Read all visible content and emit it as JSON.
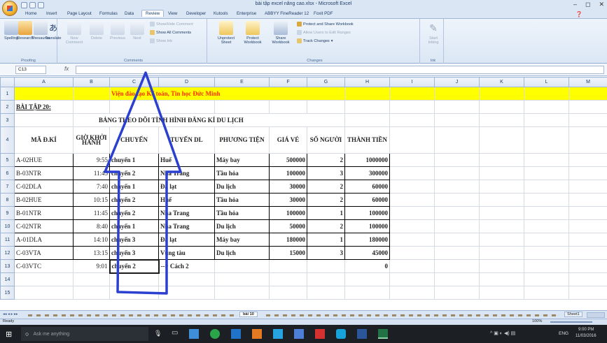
{
  "window": {
    "title": "bài tập excel nâng cao.xlsx - Microsoft Excel",
    "controls": [
      "–",
      "◻",
      "✕"
    ]
  },
  "tabs": [
    "Home",
    "Insert",
    "Page Layout",
    "Formulas",
    "Data",
    "Review",
    "View",
    "Developer",
    "Kutools",
    "Enterprise",
    "ABBYY FineReader 12",
    "Foxit PDF"
  ],
  "active_tab": "Review",
  "ribbon": {
    "proofing": {
      "label": "Proofing",
      "buttons": [
        "Spelling",
        "Research",
        "Thesaurus",
        "Translate"
      ]
    },
    "comments": {
      "label": "Comments",
      "buttons": [
        "New Comment",
        "Delete",
        "Previous",
        "Next"
      ],
      "small": [
        "Show/Hide Comment",
        "Show All Comments",
        "Show Ink"
      ]
    },
    "changes": {
      "label": "Changes",
      "buttons": [
        "Unprotect Sheet",
        "Protect Workbook",
        "Share Workbook"
      ],
      "small": [
        "Protect and Share Workbook",
        "Allow Users to Edit Ranges",
        "Track Changes"
      ]
    },
    "ink": {
      "label": "Ink",
      "buttons": [
        "Start Inking"
      ]
    }
  },
  "formula_bar": {
    "name_box": "C13",
    "fx": "fx",
    "value": ""
  },
  "columns": [
    "A",
    "B",
    "C",
    "D",
    "E",
    "F",
    "G",
    "H",
    "I",
    "J",
    "K",
    "L",
    "M"
  ],
  "sheet": {
    "banner": "Viện đào tạo Kế toán, Tin học Đức Minh",
    "exercise": "BÀI TẬP 20:",
    "title": "BẢNG THEO DÕI TÌNH HÌNH ĐĂNG KÍ DU LỊCH",
    "headers": [
      "MÃ Đ.KÍ",
      "GIỜ KHỞI HÀNH",
      "CHUYẾN",
      "TUYẾN DL",
      "PHƯƠNG TIỆN",
      "GIÁ VÉ",
      "SỐ NGƯỜI",
      "THÀNH TIỀN"
    ],
    "rows": [
      [
        "A-02HUE",
        "9:55",
        "chuyến 1",
        "Huế",
        "Máy bay",
        "500000",
        "2",
        "1000000"
      ],
      [
        "B-03NTR",
        "11:45",
        "chuyến 2",
        "Nha Trang",
        "Tầu hỏa",
        "100000",
        "3",
        "300000"
      ],
      [
        "C-02DLA",
        "7:40",
        "chuyến 1",
        "Đà lạt",
        "Du lịch",
        "30000",
        "2",
        "60000"
      ],
      [
        "B-02HUE",
        "10:15",
        "chuyến 2",
        "Huế",
        "Tầu hỏa",
        "30000",
        "2",
        "60000"
      ],
      [
        "B-01NTR",
        "11:45",
        "chuyến 2",
        "Nha Trang",
        "Tầu hỏa",
        "100000",
        "1",
        "100000"
      ],
      [
        "C-02NTR",
        "8:40",
        "chuyến 1",
        "Nha Trang",
        "Du lịch",
        "50000",
        "2",
        "100000"
      ],
      [
        "A-01DLA",
        "14:10",
        "chuyến 3",
        "Đà lạt",
        "Máy bay",
        "180000",
        "1",
        "180000"
      ],
      [
        "C-03VTA",
        "13:15",
        "chuyến 3",
        "Vũng tàu",
        "Du lịch",
        "15000",
        "3",
        "45000"
      ]
    ],
    "last_row": {
      "code": "C-03VTC",
      "time": "9:01",
      "trip": "chuyến 2",
      "note": "--> Cách 2",
      "total": "0"
    },
    "row_numbers": [
      "1",
      "2",
      "3",
      "4",
      "5",
      "6",
      "7",
      "8",
      "9",
      "10",
      "11",
      "12",
      "13",
      "14",
      "15"
    ]
  },
  "sheet_tabs": {
    "active": "bài 10",
    "right": "Sheet1"
  },
  "status": {
    "left": "Ready",
    "zoom": "100%"
  },
  "taskbar": {
    "search_placeholder": "Ask me anything",
    "lang": "ENG",
    "time": "9:00 PM",
    "date": "11/03/2016"
  },
  "annotation_color": "#2b3fd1"
}
